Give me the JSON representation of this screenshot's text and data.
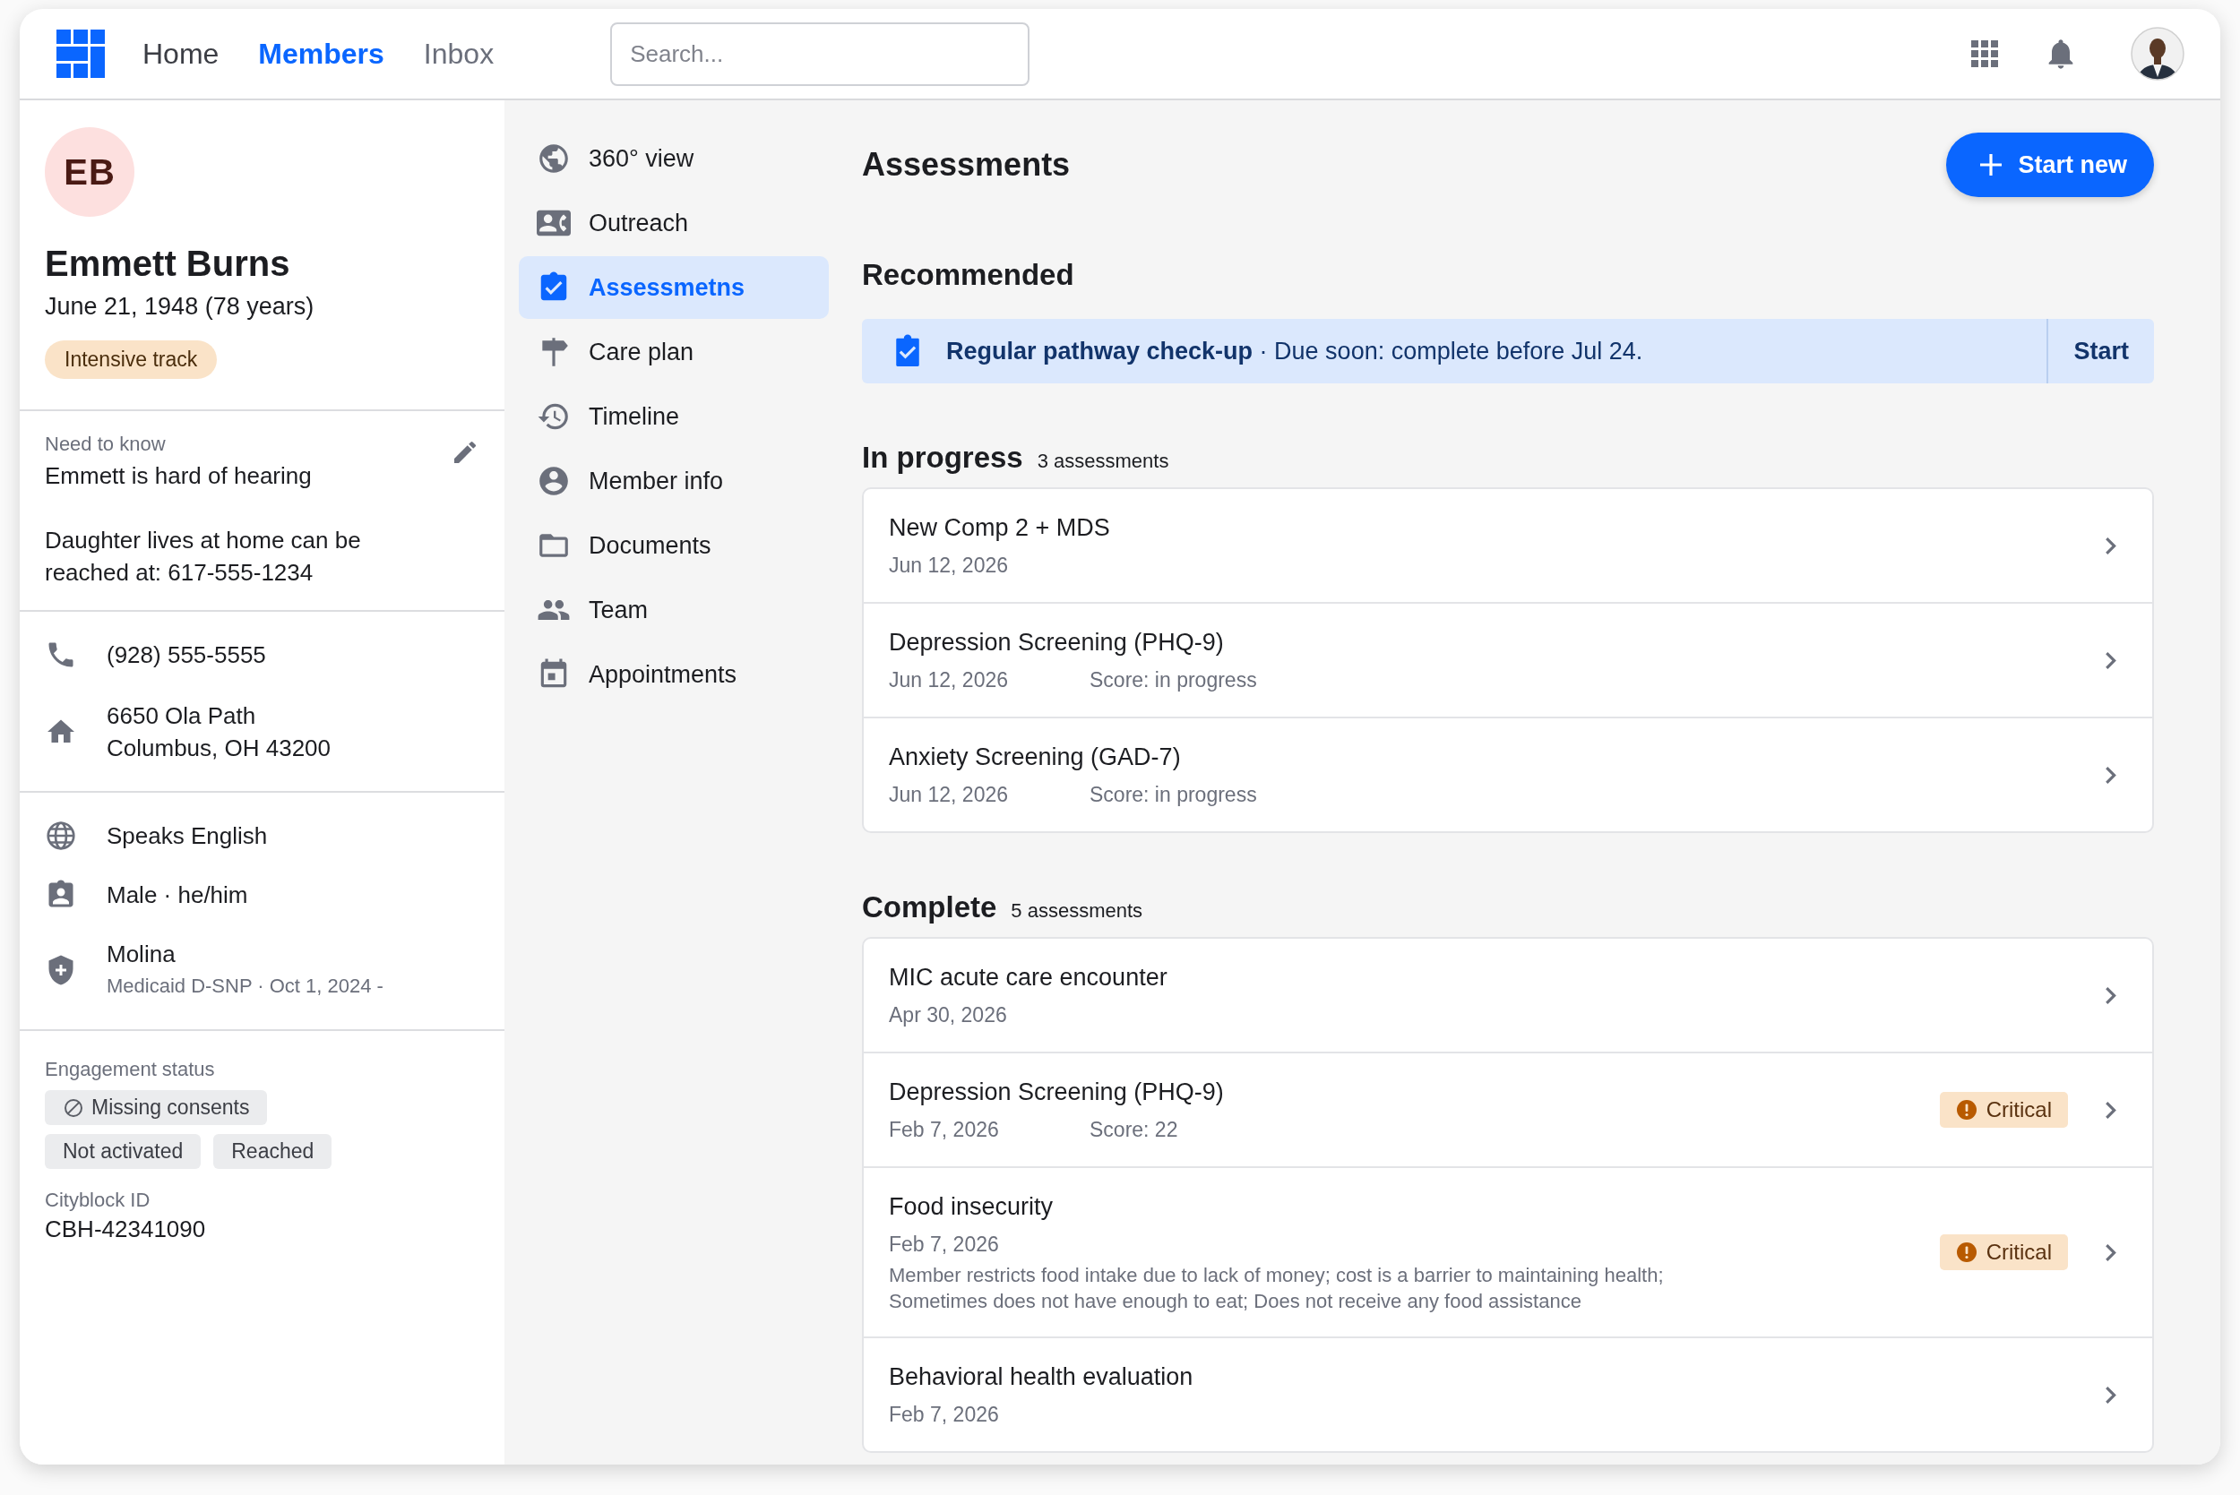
{
  "topbar": {
    "nav": [
      {
        "label": "Home",
        "selected": false
      },
      {
        "label": "Members",
        "selected": true
      },
      {
        "label": "Inbox",
        "selected": false
      }
    ],
    "search": {
      "placeholder": "Search..."
    }
  },
  "member": {
    "initials": "EB",
    "name": "Emmett Burns",
    "birth": "June 21, 1948 (78 years)",
    "track": "Intensive track",
    "need_to_know": {
      "label": "Need to know",
      "notes": [
        "Emmett is hard of hearing",
        "Daughter lives at home can be reached at: 617-555-1234"
      ]
    },
    "contact": [
      {
        "kind": "phone",
        "lines": [
          "(928) 555-5555"
        ]
      },
      {
        "kind": "home",
        "lines": [
          "6650 Ola Path",
          "Columbus, OH 43200"
        ]
      }
    ],
    "details": [
      {
        "kind": "language",
        "text": "Speaks English"
      },
      {
        "kind": "gender",
        "text": "Male · he/him"
      },
      {
        "kind": "insurance",
        "text": "Molina",
        "sub": "Medicaid D-SNP · Oct 1, 2024 -"
      }
    ],
    "engagement": {
      "label": "Engagement status",
      "tags": [
        {
          "kind": "blocked",
          "label": "Missing consents"
        },
        {
          "kind": "plain",
          "label": "Not activated"
        },
        {
          "kind": "plain",
          "label": "Reached"
        }
      ]
    },
    "id": {
      "label": "Cityblock ID",
      "value": "CBH-42341090"
    }
  },
  "sections_nav": [
    {
      "kind": "globe",
      "label": "360° view",
      "selected": false
    },
    {
      "kind": "outreach",
      "label": "Outreach",
      "selected": false
    },
    {
      "kind": "assessment",
      "label": "Assessmetns",
      "selected": true
    },
    {
      "kind": "signpost",
      "label": "Care plan",
      "selected": false
    },
    {
      "kind": "history",
      "label": "Timeline",
      "selected": false
    },
    {
      "kind": "person",
      "label": "Member info",
      "selected": false
    },
    {
      "kind": "folder",
      "label": "Documents",
      "selected": false
    },
    {
      "kind": "people",
      "label": "Team",
      "selected": false
    },
    {
      "kind": "calendar",
      "label": "Appointments",
      "selected": false
    }
  ],
  "assessments": {
    "title": "Assessments",
    "start_new": "Start new",
    "recommended": {
      "heading": "Recommended",
      "text": "**Regular pathway check-up** · Due soon: complete before Jul 24.",
      "action": "Start"
    },
    "groups": [
      {
        "title": "In progress",
        "count": "3 assessments",
        "items": [
          {
            "name": "New Comp 2 + MDS",
            "date": "Jun 12, 2026"
          },
          {
            "name": "Depression Screening (PHQ-9)",
            "date": "Jun 12, 2026",
            "score": "Score: in progress"
          },
          {
            "name": "Anxiety Screening (GAD-7)",
            "date": "Jun 12, 2026",
            "score": "Score: in progress"
          }
        ]
      },
      {
        "title": "Complete",
        "count": "5 assessments",
        "items": [
          {
            "name": "MIC acute care encounter",
            "date": "Apr 30, 2026"
          },
          {
            "name": "Depression Screening (PHQ-9)",
            "date": "Feb 7, 2026",
            "score": "Score: 22",
            "flag": "Critical"
          },
          {
            "name": "Food insecurity",
            "date": "Feb 7, 2026",
            "note": "Member restricts food intake due to lack of money; cost is a barrier to maintaining health; Sometimes does not have enough to eat; Does not receive any food assistance",
            "flag": "Critical"
          },
          {
            "name": "Behavioral health evaluation",
            "date": "Feb 7, 2026"
          }
        ]
      }
    ]
  }
}
